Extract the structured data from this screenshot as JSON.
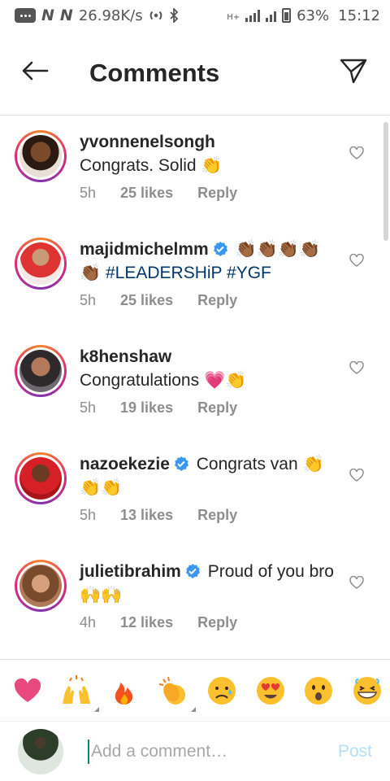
{
  "status_bar": {
    "speed": "26.98K/s",
    "battery": "63%",
    "time": "15:12",
    "network_glyph": "H+"
  },
  "header": {
    "title": "Comments"
  },
  "comments": [
    {
      "user": "yvonnenelsongh",
      "verified": false,
      "text": "Congrats. Solid",
      "emojis": "👏",
      "hashtags": "",
      "time": "5h",
      "likes": "25 likes",
      "reply": "Reply"
    },
    {
      "user": "majidmichelmm",
      "verified": true,
      "text": "",
      "emojis": "👏🏾👏🏾👏🏾👏🏾👏🏾",
      "hashtags": "#LEADERSHiP #YGF",
      "time": "5h",
      "likes": "25 likes",
      "reply": "Reply"
    },
    {
      "user": "k8henshaw",
      "verified": false,
      "text": "Congratulations",
      "emojis": "💗👏",
      "hashtags": "",
      "time": "5h",
      "likes": "19 likes",
      "reply": "Reply"
    },
    {
      "user": "nazoekezie",
      "verified": true,
      "text": "Congrats van",
      "emojis": "👏👏👏",
      "hashtags": "",
      "time": "5h",
      "likes": "13 likes",
      "reply": "Reply"
    },
    {
      "user": "julietibrahim",
      "verified": true,
      "text": "Proud of you bro",
      "emojis": "🙌🙌",
      "hashtags": "",
      "time": "4h",
      "likes": "12 likes",
      "reply": "Reply"
    }
  ],
  "quick_reactions": [
    "heart",
    "raising-hands",
    "fire",
    "clapping",
    "crying-face",
    "heart-eyes",
    "surprised-face",
    "grinning-face"
  ],
  "composer": {
    "placeholder": "Add a comment…",
    "post_label": "Post"
  },
  "colors": {
    "text": "#262626",
    "muted": "#8e8e8e",
    "hashtag": "#00376b",
    "verified": "#3897f0",
    "post_disabled": "#b2dffc"
  }
}
